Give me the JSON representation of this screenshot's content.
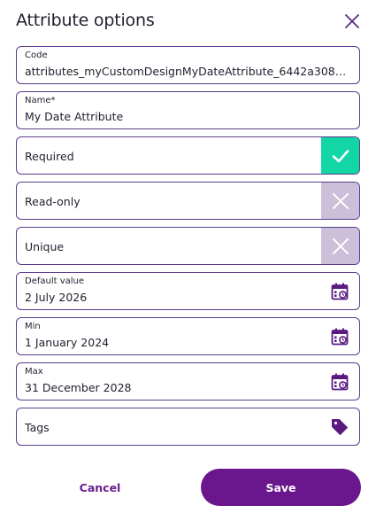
{
  "dialog": {
    "title": "Attribute options",
    "close_icon": "close-icon"
  },
  "fields": {
    "code": {
      "label": "Code",
      "value": "attributes_myCustomDesignMyDateAttribute_6442a308352c0…"
    },
    "name": {
      "label": "Name*",
      "value": "My Date Attribute"
    },
    "required": {
      "label": "Required",
      "checked": true,
      "icon": "check-icon"
    },
    "read_only": {
      "label": "Read-only",
      "checked": false,
      "icon": "x-icon"
    },
    "unique": {
      "label": "Unique",
      "checked": false,
      "icon": "x-icon"
    },
    "default_value": {
      "label": "Default value",
      "value": "2 July 2026",
      "icon": "calendar-icon"
    },
    "min": {
      "label": "Min",
      "value": "1 January 2024",
      "icon": "calendar-icon"
    },
    "max": {
      "label": "Max",
      "value": "31 December 2028",
      "icon": "calendar-icon"
    },
    "tags": {
      "label": "Tags",
      "icon": "tag-icon"
    }
  },
  "actions": {
    "cancel_label": "Cancel",
    "save_label": "Save"
  },
  "colors": {
    "accent": "#6a168c",
    "border": "#5a3c8c",
    "toggle_on": "#12d6a6",
    "toggle_off": "#cbbfd9"
  }
}
